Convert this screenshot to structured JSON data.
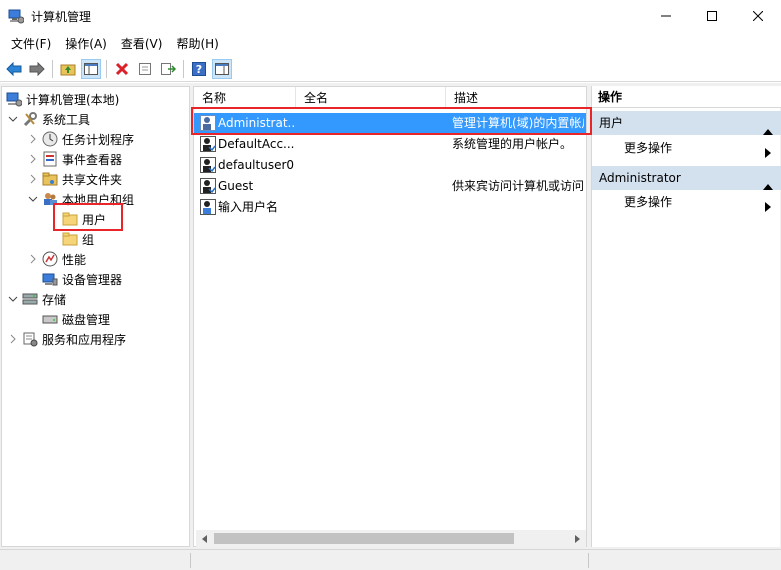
{
  "window": {
    "title": "计算机管理",
    "icon": "computer-management-icon"
  },
  "menu": [
    "文件(F)",
    "操作(A)",
    "查看(V)",
    "帮助(H)"
  ],
  "toolbar": [
    "back-icon",
    "forward-icon",
    "up-folder-icon",
    "show-hide-tree-icon",
    "delete-icon",
    "properties-icon",
    "export-icon",
    "help-icon",
    "show-action-pane-icon"
  ],
  "tree": {
    "root": "计算机管理(本地)",
    "system_tools": "系统工具",
    "task_scheduler": "任务计划程序",
    "event_viewer": "事件查看器",
    "shared_folders": "共享文件夹",
    "local_users_groups": "本地用户和组",
    "users": "用户",
    "groups": "组",
    "performance": "性能",
    "device_manager": "设备管理器",
    "storage": "存储",
    "disk_management": "磁盘管理",
    "services_apps": "服务和应用程序"
  },
  "list": {
    "columns": [
      "名称",
      "全名",
      "描述"
    ],
    "rows": [
      {
        "name": "Administrat...",
        "fullname": "",
        "desc": "管理计算机(域)的内置帐户"
      },
      {
        "name": "DefaultAcc...",
        "fullname": "",
        "desc": "系统管理的用户帐户。"
      },
      {
        "name": "defaultuser0",
        "fullname": "",
        "desc": ""
      },
      {
        "name": "Guest",
        "fullname": "",
        "desc": "供来宾访问计算机或访问域的内..."
      },
      {
        "name": "输入用户名",
        "fullname": "",
        "desc": ""
      }
    ]
  },
  "actions": {
    "title": "操作",
    "sections": [
      {
        "header": "用户",
        "item": "更多操作"
      },
      {
        "header": "Administrator",
        "item": "更多操作"
      }
    ]
  },
  "colors": {
    "selection": "#3399ff",
    "section_bg": "#d3e0ee",
    "highlight": "#e8262a"
  }
}
